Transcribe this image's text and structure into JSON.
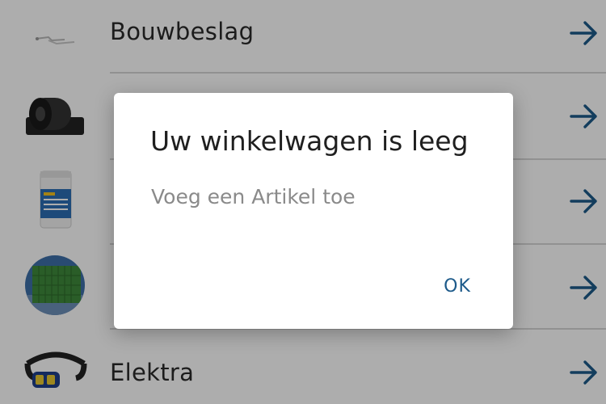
{
  "categories": [
    {
      "label": "Bouwbeslag",
      "thumbnail": "bracket-hardware-image"
    },
    {
      "label": "",
      "thumbnail": "roofing-roll-image"
    },
    {
      "label": "",
      "thumbnail": "paint-bucket-image"
    },
    {
      "label": "",
      "thumbnail": "green-fence-panel-image"
    },
    {
      "label": "Elektra",
      "thumbnail": "headlamp-image"
    }
  ],
  "dialog": {
    "title": "Uw winkelwagen is leeg",
    "message": "Voeg een Artikel toe",
    "ok_label": "OK"
  },
  "colors": {
    "accent": "#1d5a8a",
    "arrow": "#1d5a8a",
    "overlay": "rgba(0,0,0,0.32)"
  },
  "icons": {
    "row_action": "arrow-right-icon"
  }
}
